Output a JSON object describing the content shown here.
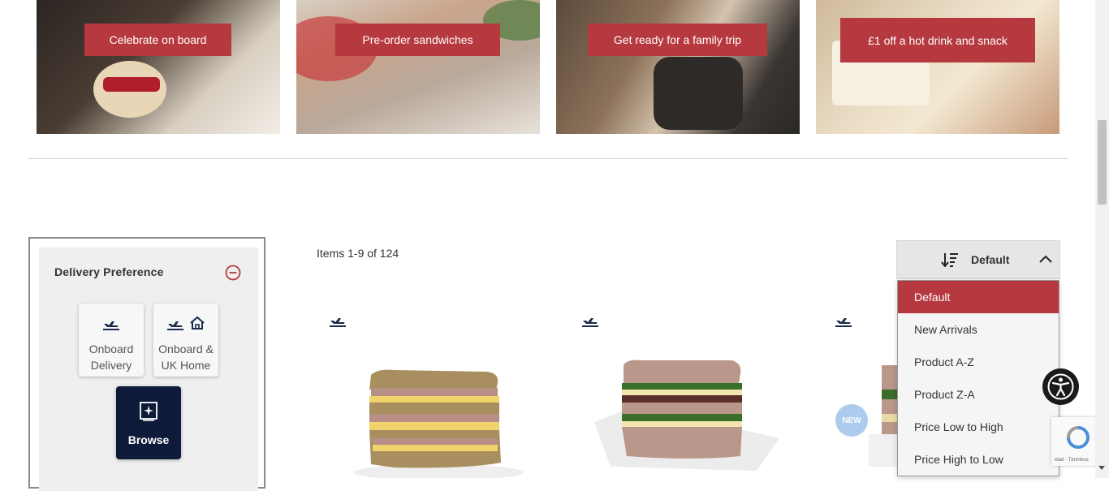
{
  "promos": [
    {
      "label": "Celebrate on board"
    },
    {
      "label": "Pre-order  sandwiches"
    },
    {
      "label": "Get ready for a family trip"
    },
    {
      "label": "£1 off a hot drink and snack"
    }
  ],
  "sidebar": {
    "title": "Delivery Preference",
    "options": [
      {
        "label": "Onboard Delivery",
        "icon": "plane-departure-icon"
      },
      {
        "label": "Onboard & UK Home",
        "icon": "plane-departure-and-home-icon"
      },
      {
        "label": "Browse",
        "icon": "browse-icon",
        "selected": true
      }
    ]
  },
  "products": {
    "items_count": "Items 1-9 of 124",
    "badge": "NEW"
  },
  "sort": {
    "current": "Default",
    "options": [
      "Default",
      "New Arrivals",
      "Product A-Z",
      "Product Z-A",
      "Price Low to High",
      "Price High to Low"
    ],
    "active_index": 0
  },
  "recaptcha": {
    "terms": "idad - Términos"
  },
  "colors": {
    "accent": "#b5393e",
    "navy": "#0e1a3a",
    "panel": "#efefef"
  }
}
